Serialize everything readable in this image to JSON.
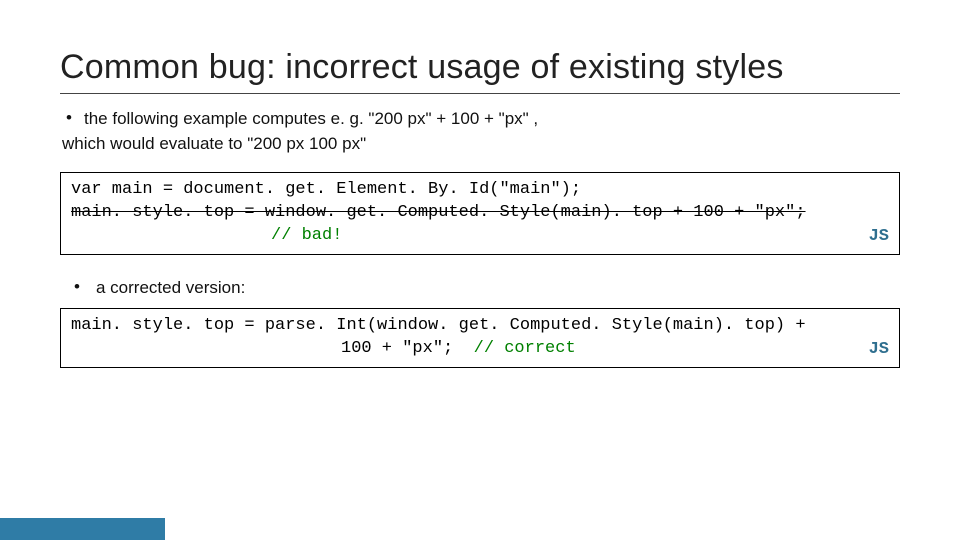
{
  "title": "Common bug: incorrect usage of existing styles",
  "bullet1": {
    "line1": "the following example computes e. g. \"200 px\" + 100 + \"px\" ,",
    "line2": "which would evaluate to \"200 px 100 px\""
  },
  "code1": {
    "line1": "var main = document. get. Element. By. Id(\"main\");",
    "line2": "main. style. top = window. get. Computed. Style(main). top + 100 + \"px\";",
    "comment": "// bad!",
    "lang": "JS"
  },
  "bullet2": "a corrected version:",
  "code2": {
    "line1": "main. style. top = parse. Int(window. get. Computed. Style(main). top) +",
    "line2a": "100 + \"px\";",
    "comment": "// correct",
    "lang": "JS"
  }
}
